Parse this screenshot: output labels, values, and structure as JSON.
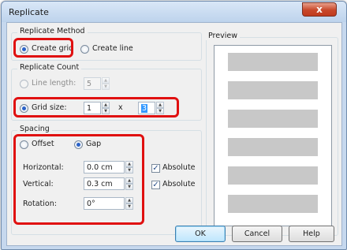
{
  "window": {
    "title": "Replicate",
    "close_glyph": "x"
  },
  "replicate_method": {
    "group_label": "Replicate Method",
    "create_grid": {
      "label": "Create grid",
      "checked": true
    },
    "create_line": {
      "label": "Create line",
      "checked": false
    }
  },
  "replicate_count": {
    "group_label": "Replicate Count",
    "line_length": {
      "label": "Line length:",
      "value": "5",
      "enabled": false
    },
    "grid_size": {
      "label": "Grid size:",
      "columns": "1",
      "separator": "x",
      "rows": "3",
      "checked": true
    }
  },
  "spacing": {
    "group_label": "Spacing",
    "offset_label": "Offset",
    "gap_label": "Gap",
    "selected": "Gap",
    "horizontal": {
      "label": "Horizontal:",
      "value": "0.0 cm",
      "absolute_label": "Absolute",
      "absolute_checked": true
    },
    "vertical": {
      "label": "Vertical:",
      "value": "0.3 cm",
      "absolute_label": "Absolute",
      "absolute_checked": true
    },
    "rotation": {
      "label": "Rotation:",
      "value": "0°"
    }
  },
  "preview": {
    "group_label": "Preview",
    "tile_count": 6
  },
  "buttons": {
    "ok": "OK",
    "cancel": "Cancel",
    "help": "Help"
  },
  "colors": {
    "highlight": "#e01010",
    "tile": "#c8c8c8",
    "accent": "#3399ff"
  }
}
